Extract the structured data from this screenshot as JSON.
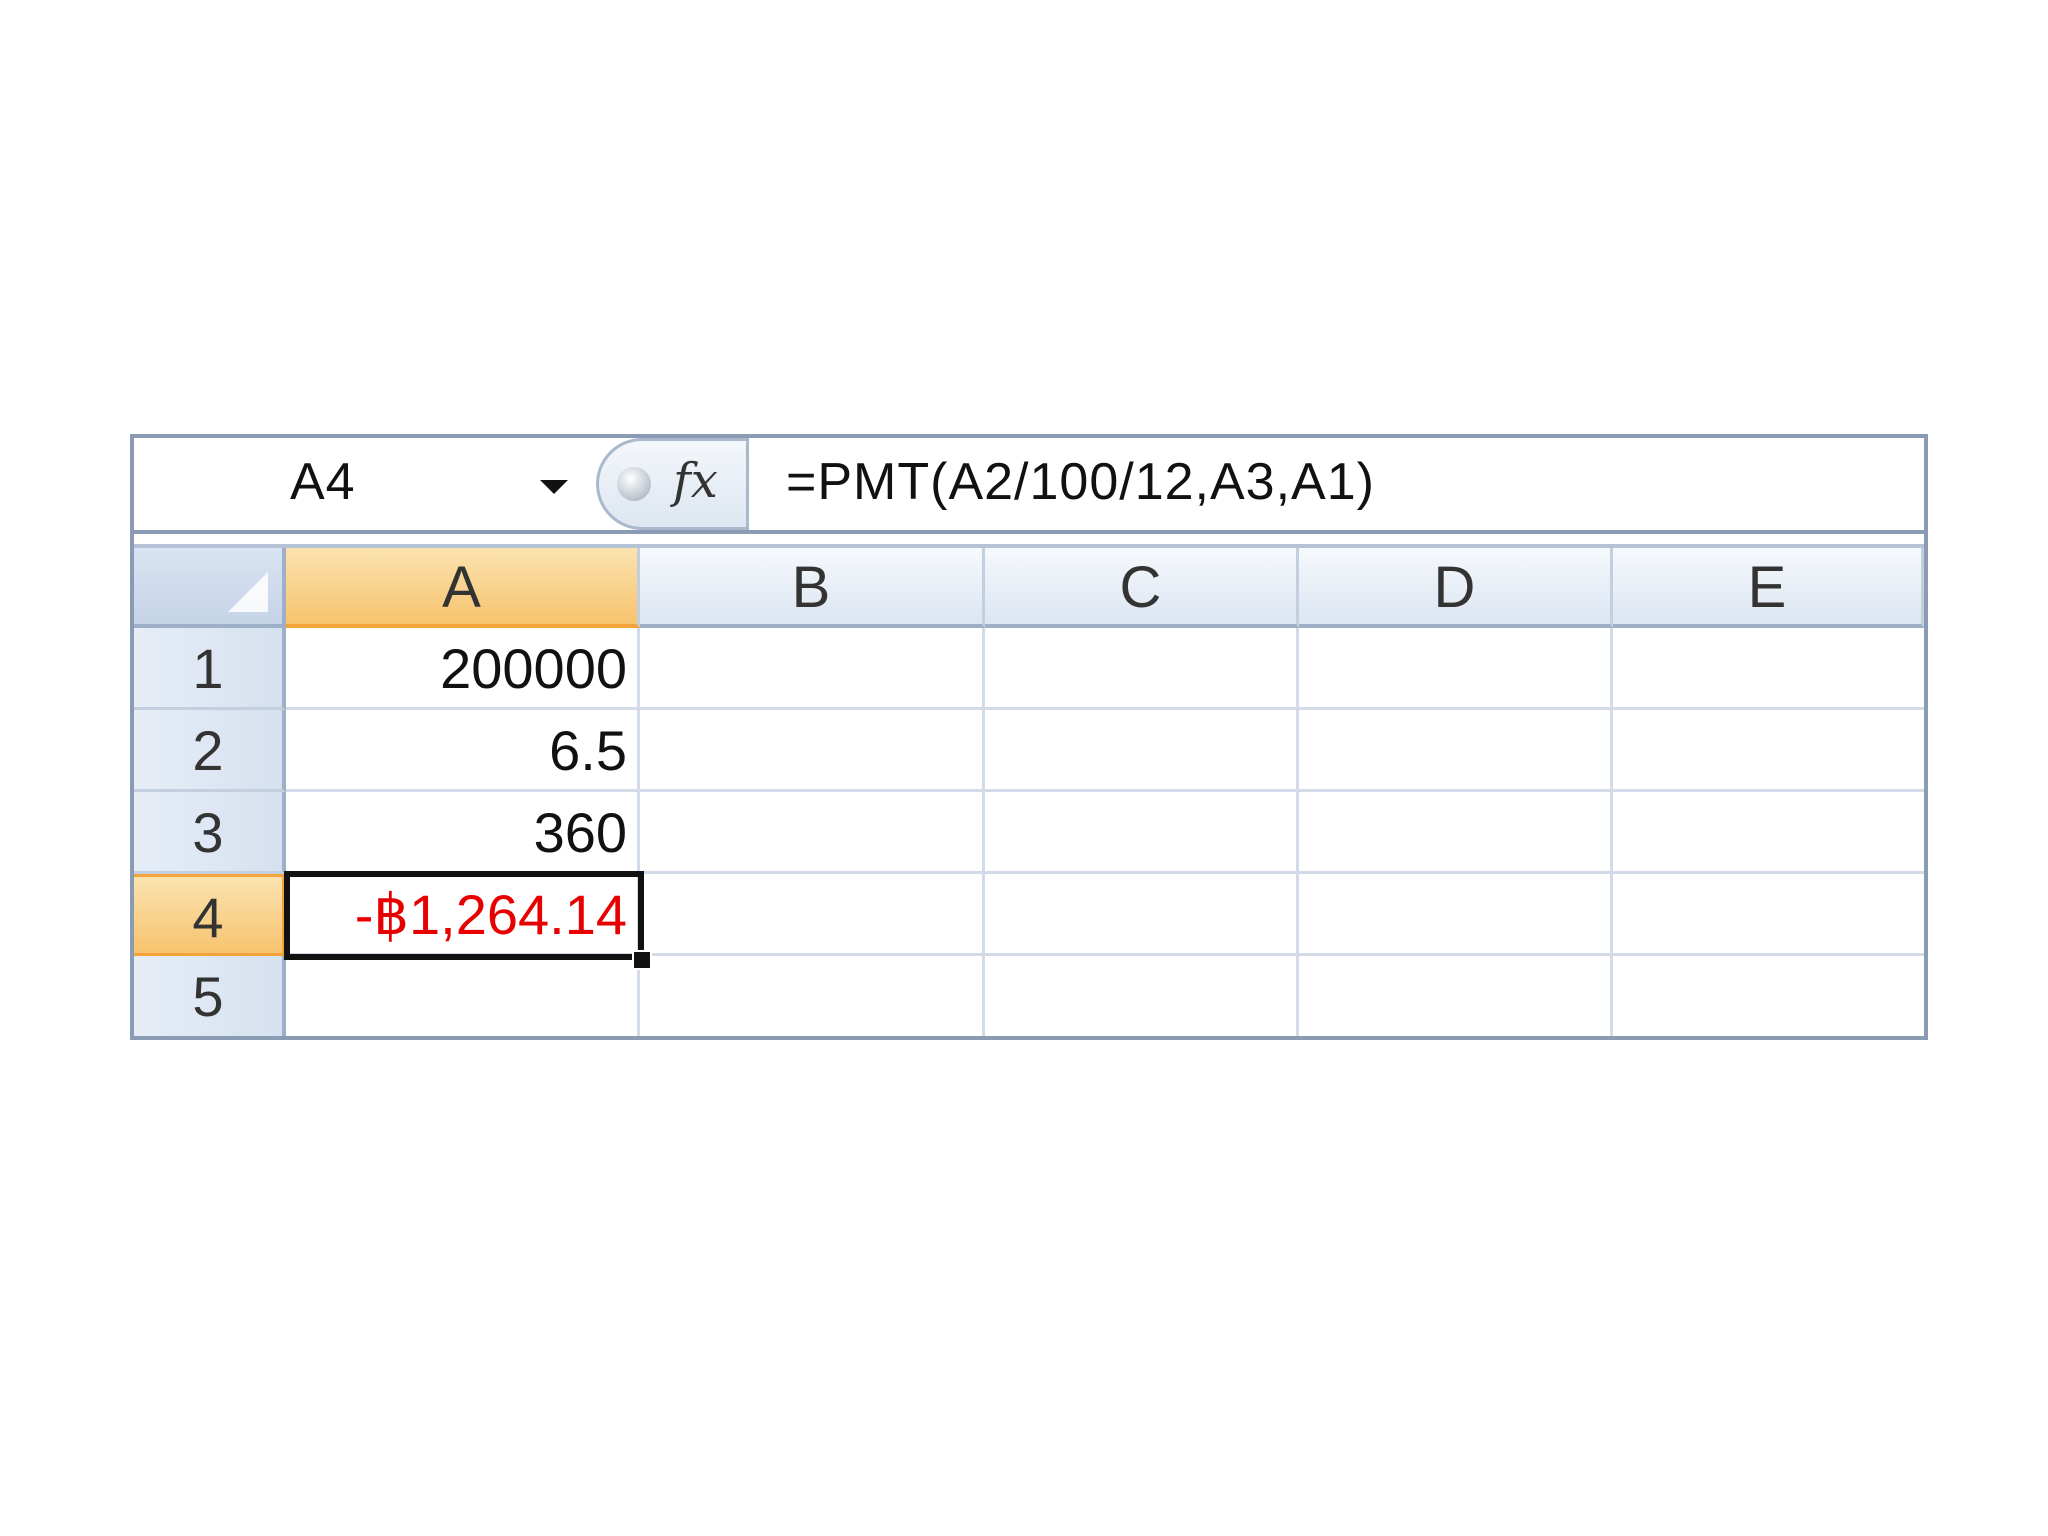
{
  "formula_bar": {
    "name_box": "A4",
    "fx_label": "fx",
    "formula": "=PMT(A2/100/12,A3,A1)"
  },
  "sheet": {
    "columns": [
      "A",
      "B",
      "C",
      "D",
      "E"
    ],
    "rows": [
      "1",
      "2",
      "3",
      "4",
      "5"
    ],
    "active_cell": "A4",
    "cells": {
      "A1": "200000",
      "A2": "6.5",
      "A3": "360",
      "A4": "-฿1,264.14",
      "A5": ""
    },
    "colors": {
      "negative_value": "#e60000",
      "active_header": "#f7c36e",
      "header": "#dce5f1",
      "gridline": "#d2dbe7"
    }
  }
}
